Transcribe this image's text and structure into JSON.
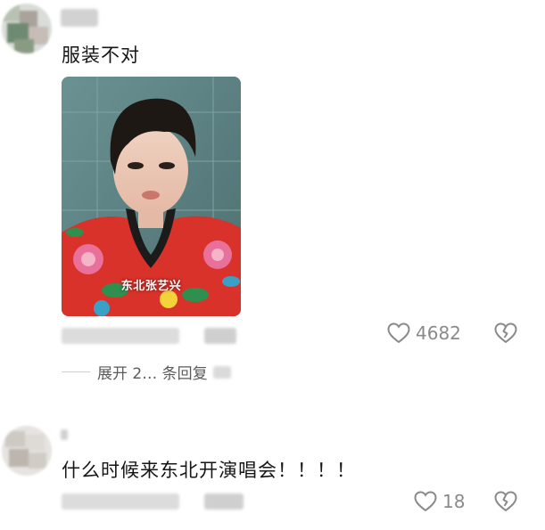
{
  "comments": [
    {
      "text": "服装不对",
      "image_caption": "东北张艺兴",
      "like_count": "4682",
      "replies_label": "展开 2… 条回复"
    },
    {
      "text": "什么时候来东北开演唱会！！！！",
      "like_count": "18"
    }
  ],
  "colors": {
    "icon_gray": "#8a8a8a",
    "jacket_red": "#d8322a",
    "wall_teal": "#5a7e80"
  },
  "icons": [
    "heart-outline-icon",
    "broken-heart-icon",
    "avatar-placeholder"
  ]
}
